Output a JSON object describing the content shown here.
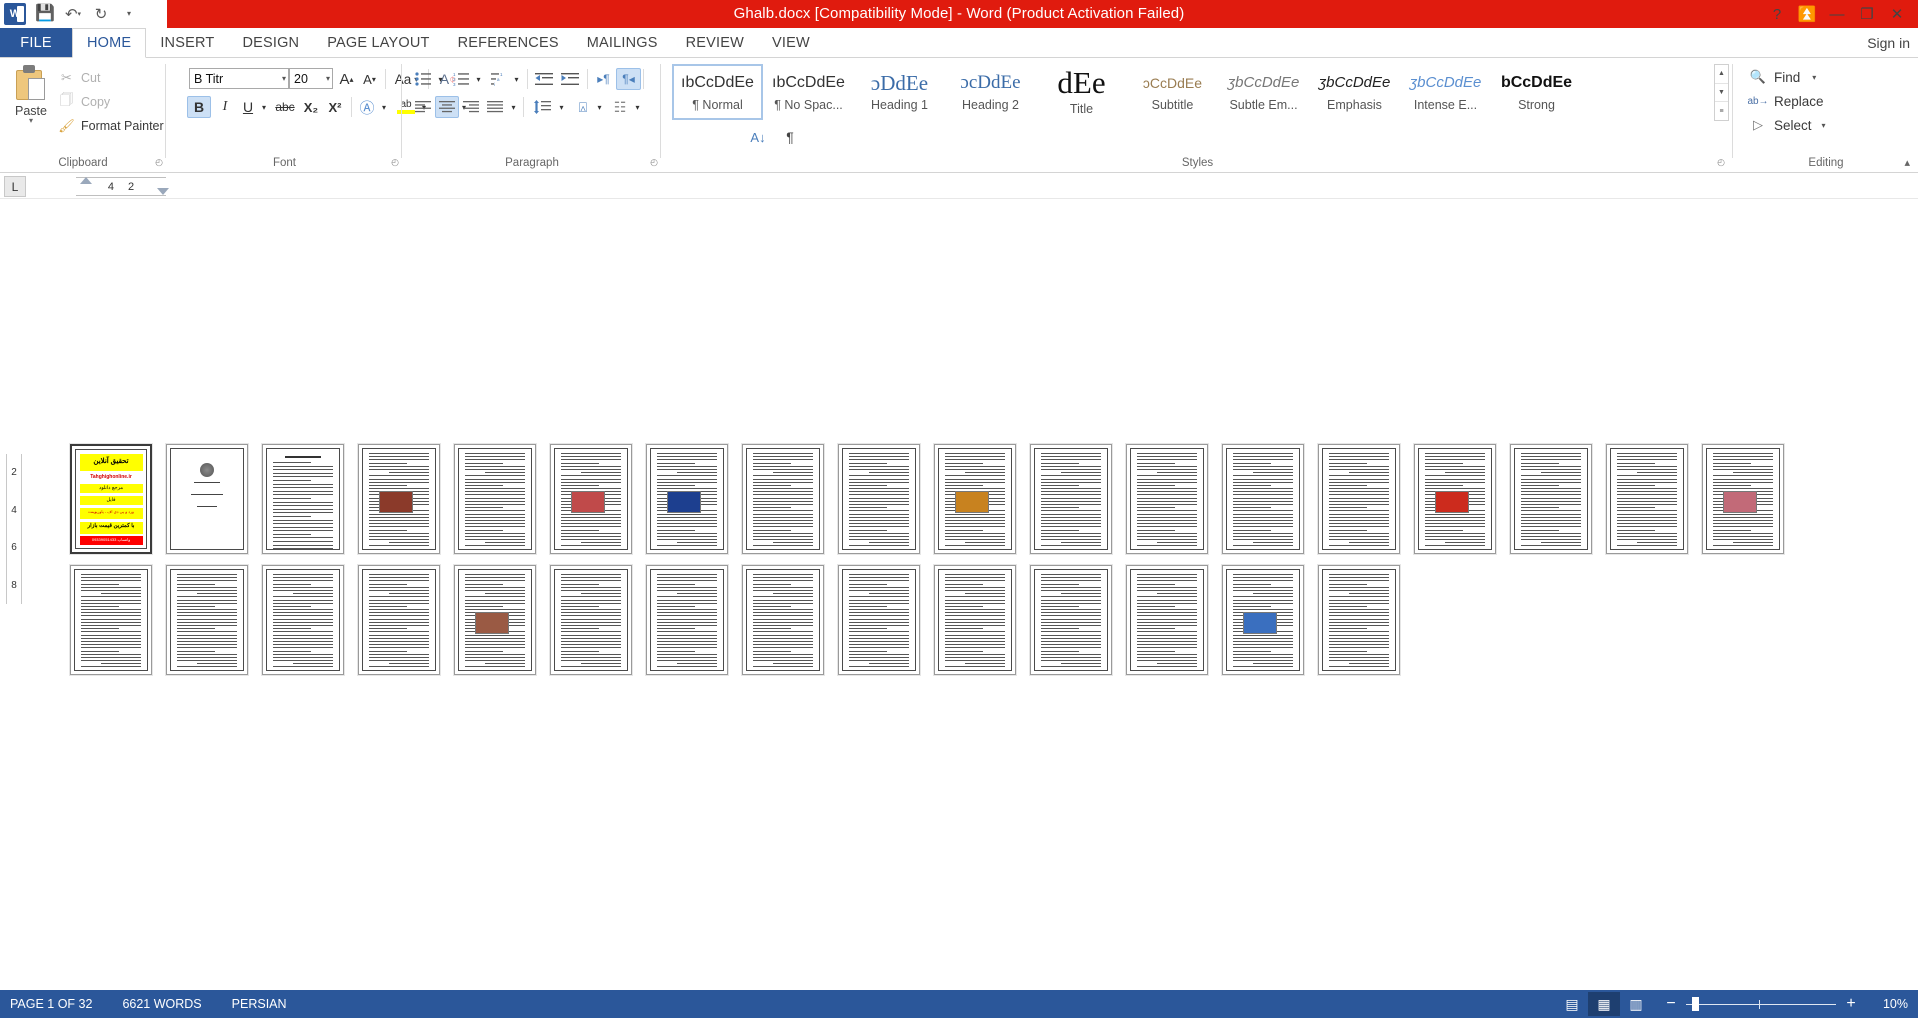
{
  "titlebar": {
    "title": "Ghalb.docx [Compatibility Mode]  -  Word (Product Activation Failed)",
    "app_icon": "word-logo-icon",
    "quick_access": [
      {
        "name": "save-icon",
        "glyph": "▣"
      },
      {
        "name": "undo-icon",
        "glyph": "↶"
      },
      {
        "name": "redo-icon",
        "glyph": "↻"
      },
      {
        "name": "customize-qat-icon",
        "glyph": "▾"
      }
    ],
    "window_controls": [
      {
        "name": "help-icon",
        "glyph": "?"
      },
      {
        "name": "ribbon-display-options-icon",
        "glyph": "⬆"
      },
      {
        "name": "minimize-icon",
        "glyph": "—"
      },
      {
        "name": "restore-icon",
        "glyph": "❐"
      },
      {
        "name": "close-icon",
        "glyph": "✕"
      }
    ]
  },
  "tabs": {
    "file_label": "FILE",
    "items": [
      {
        "label": "HOME",
        "active": true
      },
      {
        "label": "INSERT",
        "active": false
      },
      {
        "label": "DESIGN",
        "active": false
      },
      {
        "label": "PAGE LAYOUT",
        "active": false
      },
      {
        "label": "REFERENCES",
        "active": false
      },
      {
        "label": "MAILINGS",
        "active": false
      },
      {
        "label": "REVIEW",
        "active": false
      },
      {
        "label": "VIEW",
        "active": false
      }
    ],
    "signin": "Sign in"
  },
  "ribbon": {
    "clipboard": {
      "group_label": "Clipboard",
      "paste_label": "Paste",
      "cut_label": "Cut",
      "copy_label": "Copy",
      "format_painter_label": "Format Painter"
    },
    "font": {
      "group_label": "Font",
      "font_name": "B Titr",
      "font_size": "20",
      "grow_font": "A",
      "shrink_font": "A",
      "change_case": "Aa",
      "clear_formatting": "A",
      "bold": "B",
      "italic": "I",
      "underline": "U",
      "strikethrough": "abc",
      "subscript": "X₂",
      "superscript": "X²",
      "text_effects": "A",
      "highlight": "ab",
      "font_color": "A"
    },
    "paragraph": {
      "group_label": "Paragraph",
      "bullets": "bullets-icon",
      "numbering": "numbering-icon",
      "multilevel": "multilevel-list-icon",
      "decrease_indent": "decrease-indent-icon",
      "increase_indent": "increase-indent-icon",
      "ltr": "▸¶",
      "rtl": "¶◂",
      "sort": "A↓",
      "show_marks": "¶",
      "align_left": "align-left-icon",
      "align_center": "align-center-icon",
      "align_right": "align-right-icon",
      "justify": "justify-icon",
      "line_spacing": "line-spacing-icon",
      "shading": "shading-icon",
      "borders": "borders-icon"
    },
    "styles": {
      "group_label": "Styles",
      "items": [
        {
          "preview": "ıbCcDdEe",
          "name": "¶ Normal",
          "selected": true,
          "style": "normal"
        },
        {
          "preview": "ıbCcDdEe",
          "name": "¶ No Spac...",
          "selected": false,
          "style": "normal"
        },
        {
          "preview": "ɔDdEe",
          "name": "Heading 1",
          "selected": false,
          "style": "heading1"
        },
        {
          "preview": "ɔcDdEe",
          "name": "Heading 2",
          "selected": false,
          "style": "heading2"
        },
        {
          "preview": "dEe",
          "name": "Title",
          "selected": false,
          "style": "title"
        },
        {
          "preview": "ɔCcDdEe",
          "name": "Subtitle",
          "selected": false,
          "style": "subtitle"
        },
        {
          "preview": "ʒbCcDdEe",
          "name": "Subtle Em...",
          "selected": false,
          "style": "subtle-em"
        },
        {
          "preview": "ʒbCcDdEe",
          "name": "Emphasis",
          "selected": false,
          "style": "emphasis"
        },
        {
          "preview": "ʒbCcDdEe",
          "name": "Intense E...",
          "selected": false,
          "style": "intense-em"
        },
        {
          "preview": "bCcDdEe",
          "name": "Strong",
          "selected": false,
          "style": "strong"
        }
      ],
      "scroll": [
        {
          "name": "styles-scroll-up",
          "glyph": "▲"
        },
        {
          "name": "styles-scroll-down",
          "glyph": "▼"
        },
        {
          "name": "styles-more",
          "glyph": "≡"
        }
      ]
    },
    "editing": {
      "group_label": "Editing",
      "find_label": "Find",
      "replace_label": "Replace",
      "select_label": "Select"
    },
    "collapse_glyph": "▴"
  },
  "ruler": {
    "tab_selector": "L",
    "marks": [
      "4",
      "2"
    ],
    "vertical_marks": [
      "2",
      "4",
      "6",
      "8"
    ]
  },
  "document": {
    "page_count": 32,
    "selected_page": 1,
    "cover": {
      "line1": "تحقیق آنلاین",
      "line2": "Tahghighonline.ir",
      "line3": "مرجع دانلود",
      "line4": "فایل",
      "line5": "ورد و پی دی اف - پاورپوینت",
      "line6": "با کمترین قیمت بازار",
      "line7": "09339051433 واتساپ"
    },
    "pages": [
      {
        "n": 1,
        "type": "cover"
      },
      {
        "n": 2,
        "type": "titlepage"
      },
      {
        "n": 3,
        "type": "toc"
      },
      {
        "n": 4,
        "type": "text-image",
        "img": "heart-thumb",
        "imgcolor": "#8b3a2a"
      },
      {
        "n": 5,
        "type": "text"
      },
      {
        "n": 6,
        "type": "text-image",
        "img": "heart-diagram-thumb",
        "imgcolor": "#c04a4a"
      },
      {
        "n": 7,
        "type": "text-image",
        "img": "blue-chart-thumb",
        "imgcolor": "#1d3f8f"
      },
      {
        "n": 8,
        "type": "text"
      },
      {
        "n": 9,
        "type": "text"
      },
      {
        "n": 10,
        "type": "text-image",
        "img": "food-thumb",
        "imgcolor": "#c8821f"
      },
      {
        "n": 11,
        "type": "text"
      },
      {
        "n": 12,
        "type": "text"
      },
      {
        "n": 13,
        "type": "text"
      },
      {
        "n": 14,
        "type": "text"
      },
      {
        "n": 15,
        "type": "text-image",
        "img": "tomato-thumb",
        "imgcolor": "#cc2b1d"
      },
      {
        "n": 16,
        "type": "text"
      },
      {
        "n": 17,
        "type": "text"
      },
      {
        "n": 18,
        "type": "text-image",
        "img": "heart-pink-thumb",
        "imgcolor": "#c26a78"
      },
      {
        "n": 19,
        "type": "text"
      },
      {
        "n": 20,
        "type": "text"
      },
      {
        "n": 21,
        "type": "text"
      },
      {
        "n": 22,
        "type": "text"
      },
      {
        "n": 23,
        "type": "text-image",
        "img": "medical-photo-thumb",
        "imgcolor": "#9a5a44"
      },
      {
        "n": 24,
        "type": "text"
      },
      {
        "n": 25,
        "type": "text"
      },
      {
        "n": 26,
        "type": "text"
      },
      {
        "n": 27,
        "type": "text"
      },
      {
        "n": 28,
        "type": "text"
      },
      {
        "n": 29,
        "type": "text"
      },
      {
        "n": 30,
        "type": "text"
      },
      {
        "n": 31,
        "type": "text-image",
        "img": "heart-illustration-thumb",
        "imgcolor": "#3a6fbf"
      },
      {
        "n": 32,
        "type": "text"
      }
    ]
  },
  "statusbar": {
    "page_info": "PAGE 1 OF 32",
    "word_count": "6621 WORDS",
    "language": "PERSIAN",
    "views": [
      {
        "name": "read-mode-icon",
        "glyph": "▤",
        "active": false
      },
      {
        "name": "print-layout-icon",
        "glyph": "▦",
        "active": true
      },
      {
        "name": "web-layout-icon",
        "glyph": "▥",
        "active": false
      }
    ],
    "zoom_out": "−",
    "zoom_in": "+",
    "zoom_level": "10%"
  }
}
